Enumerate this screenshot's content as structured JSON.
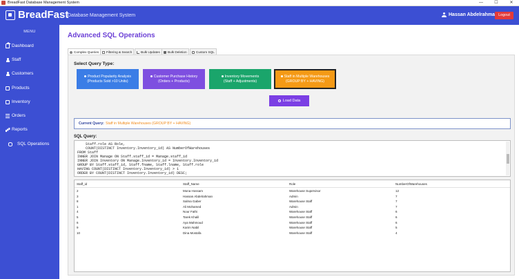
{
  "window": {
    "title": "BreadFast Database Management System",
    "minimize": "—",
    "maximize": "☐",
    "close": "✕"
  },
  "header": {
    "brand": "BreadFast",
    "subtitle": "Database Management System",
    "user": "Hassan Abdelrahman",
    "logout": "Logout"
  },
  "sidebar": {
    "menu_title": "MENU",
    "items": [
      {
        "label": "Dashboard",
        "icon": "home-icon"
      },
      {
        "label": "Staff",
        "icon": "person-icon"
      },
      {
        "label": "Customers",
        "icon": "person-icon"
      },
      {
        "label": "Products",
        "icon": "box-icon"
      },
      {
        "label": "Inventory",
        "icon": "box-icon"
      },
      {
        "label": "Orders",
        "icon": "list-icon"
      },
      {
        "label": "Reports",
        "icon": "chart-icon"
      },
      {
        "label": "SQL Operations",
        "icon": "database-icon"
      }
    ]
  },
  "page": {
    "title": "Advanced SQL Operations"
  },
  "tabs": [
    {
      "label": "Complex Queries"
    },
    {
      "label": "Filtering & Search"
    },
    {
      "label": "Bulk Updates"
    },
    {
      "label": "Bulk Deletion"
    },
    {
      "label": "Custom SQL"
    }
  ],
  "query_section": {
    "label": "Select Query Type:"
  },
  "query_buttons": [
    {
      "line1": "Product Popularity Analysis",
      "line2": "(Products Sold >10 Units)",
      "color": "#3b7de6"
    },
    {
      "line1": "Customer Purchase History",
      "line2": "(Orders + Products)",
      "color": "#7e4fe0"
    },
    {
      "line1": "Inventory Movements",
      "line2": "(Staff + Adjustments)",
      "color": "#1aa56b"
    },
    {
      "line1": "Staff in Multiple Warehouses",
      "line2": "(GROUP BY + HAVING)",
      "color": "#f59a16"
    }
  ],
  "load_button": {
    "label": "Load Data",
    "color": "#7b3fe4"
  },
  "current_query": {
    "label": "Current Query:",
    "value": "Staff in Multiple Warehouses (GROUP BY + HAVING)"
  },
  "sql": {
    "label": "SQL Query:",
    "lines": [
      "    Staff.role AS Role,",
      "    COUNT(DISTINCT Inventory.Inventory_id) AS NumberOfWarehouses",
      "FROM Staff",
      "INNER JOIN Manage ON Staff.staff_id = Manage.staff_id",
      "INNER JOIN Inventory ON Manage.Inventory_id = Inventory.Inventory_id",
      "GROUP BY Staff.staff_id, Staff.fname, Staff.lname, Staff.role",
      "HAVING COUNT(DISTINCT Inventory.Inventory_id) > 1",
      "ORDER BY COUNT(DISTINCT Inventory.Inventory_id) DESC;"
    ]
  },
  "results": {
    "columns": [
      "Staff_id",
      "Staff_Name",
      "Role",
      "NumberOfWarehouses"
    ],
    "rows": [
      [
        "2",
        "Mona Hossam",
        "Warehouse Supervisor",
        "12"
      ],
      [
        "3",
        "Hassan Abdelrahman",
        "Admin",
        "7"
      ],
      [
        "8",
        "Salma Gaber",
        "Warehouse Staff",
        "7"
      ],
      [
        "1",
        "Ali Mohamed",
        "Admin",
        "7"
      ],
      [
        "4",
        "Nour Fathi",
        "Warehouse Staff",
        "6"
      ],
      [
        "5",
        "Tarek Khalil",
        "Warehouse Staff",
        "6"
      ],
      [
        "6",
        "Aya Mahmoud",
        "Warehouse Staff",
        "6"
      ],
      [
        "9",
        "Karim Nabil",
        "Warehouse Staff",
        "5"
      ],
      [
        "10",
        "Dina Mostafa",
        "Warehouse Staff",
        "4"
      ]
    ]
  },
  "colors": {
    "primary": "#3c4fd3",
    "accent": "#6b3fd6",
    "danger": "#e43a3a",
    "highlight": "#f08a1a"
  }
}
